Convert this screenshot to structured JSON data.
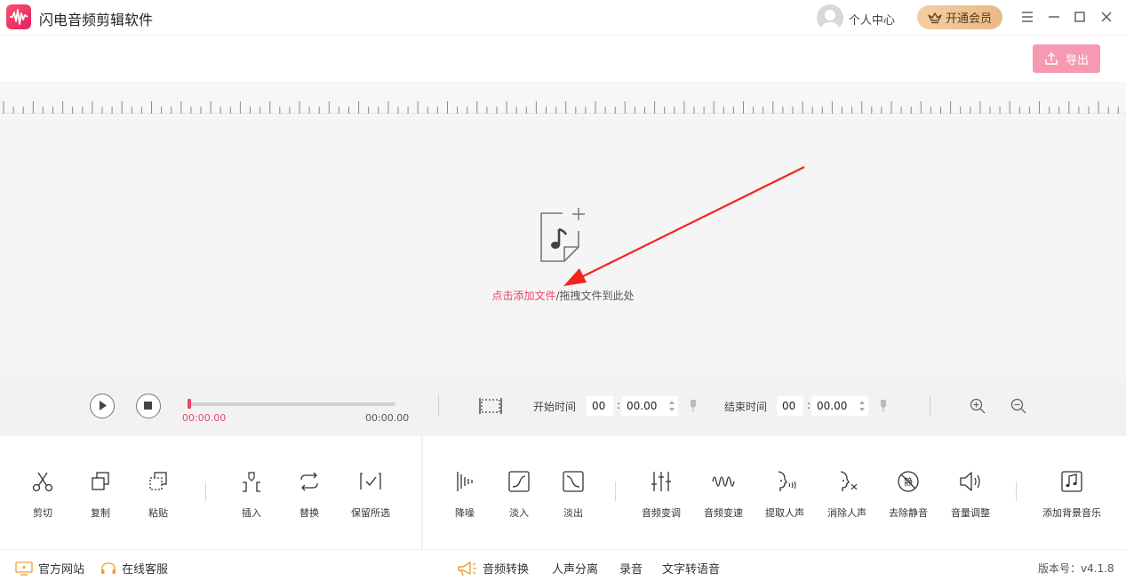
{
  "app": {
    "title": "闪电音频剪辑软件"
  },
  "header": {
    "user_center": "个人中心",
    "vip": "开通会员"
  },
  "toolbar": {
    "export": "导出"
  },
  "drop": {
    "link": "点击添加文件",
    "rest": "/拖拽文件到此处"
  },
  "playback": {
    "current_time": "00:00.00",
    "total_time": "00:00.00",
    "progress": 0,
    "start_label": "开始时间",
    "end_label": "结束时间",
    "start_min": "00",
    "start_sec": "00.00",
    "end_min": "00",
    "end_sec": "00.00"
  },
  "tools": {
    "cut": "剪切",
    "copy": "复制",
    "paste": "粘贴",
    "insert": "插入",
    "replace": "替换",
    "keep": "保留所选",
    "denoise": "降噪",
    "fadein": "淡入",
    "fadeout": "淡出",
    "pitch": "音频变调",
    "speed": "音频变速",
    "extract_voice": "提取人声",
    "remove_voice": "消除人声",
    "remove_silence": "去除静音",
    "volume": "音量调整",
    "bgm": "添加背景音乐"
  },
  "footer": {
    "website": "官方网站",
    "support": "在线客服",
    "convert": "音频转换",
    "separate": "人声分离",
    "record": "录音",
    "tts": "文字转语音",
    "version": "版本号：v4.1.8"
  },
  "colors": {
    "accent": "#e8476b",
    "export_bg": "#f59ab1",
    "vip_bg": "#e9b989"
  }
}
